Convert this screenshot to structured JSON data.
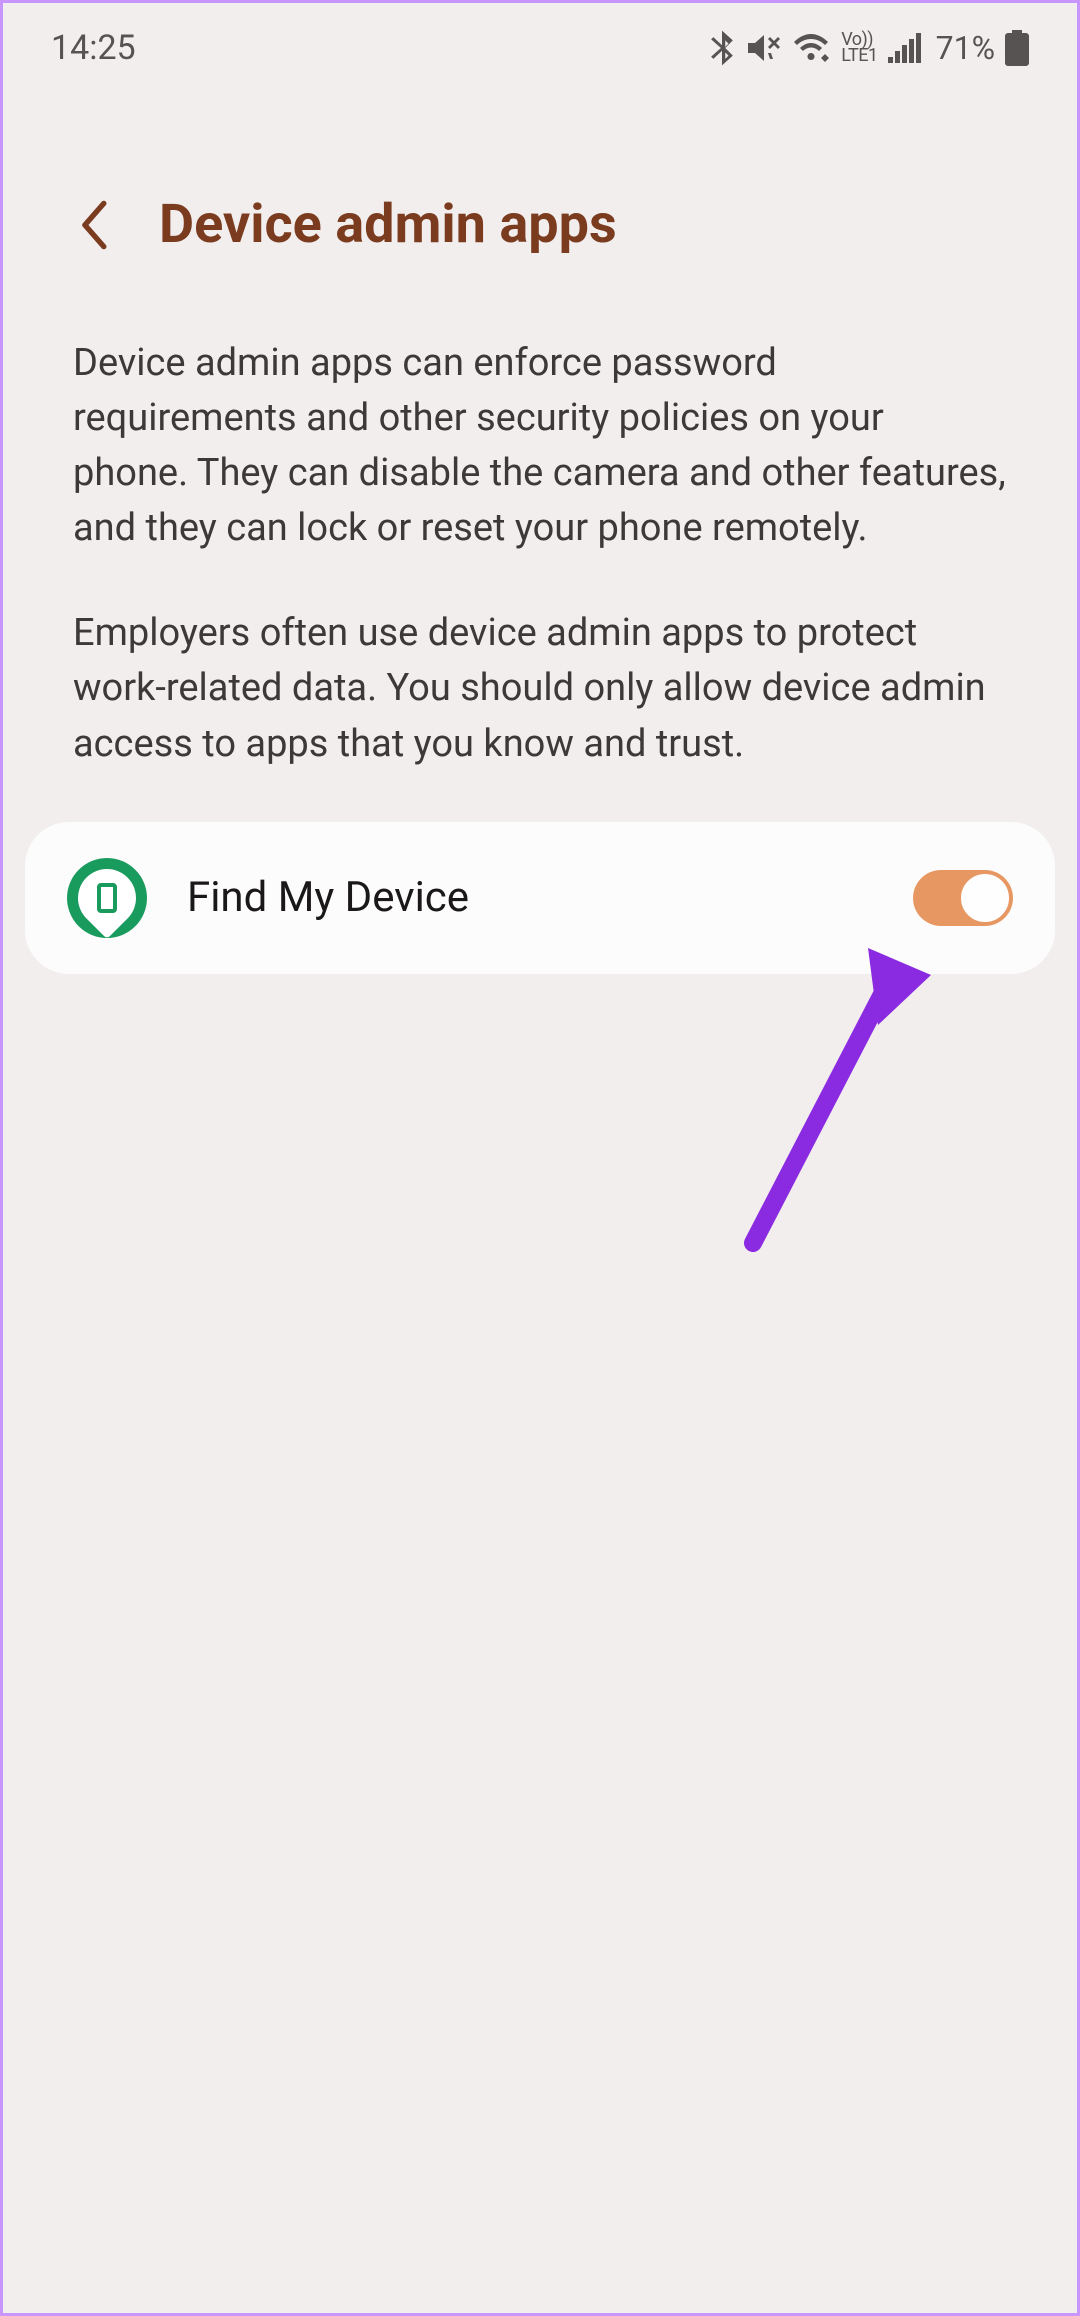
{
  "status": {
    "time": "14:25",
    "battery": "71%",
    "volte": "Vo))\nLTE1"
  },
  "header": {
    "title": "Device admin apps"
  },
  "description": {
    "p1": "Device admin apps can enforce password requirements and other security policies on your phone. They can disable the camera and other features, and they can lock or reset your phone remotely.",
    "p2": "Employers often use device admin apps to protect work-related data. You should only allow device admin access to apps that you know and trust."
  },
  "apps": [
    {
      "name": "Find My Device",
      "enabled": true
    }
  ],
  "colors": {
    "accent": "#7a3b1f",
    "toggle_on": "#e79862",
    "app_icon": "#1a9b5e",
    "arrow": "#8a2be2"
  }
}
